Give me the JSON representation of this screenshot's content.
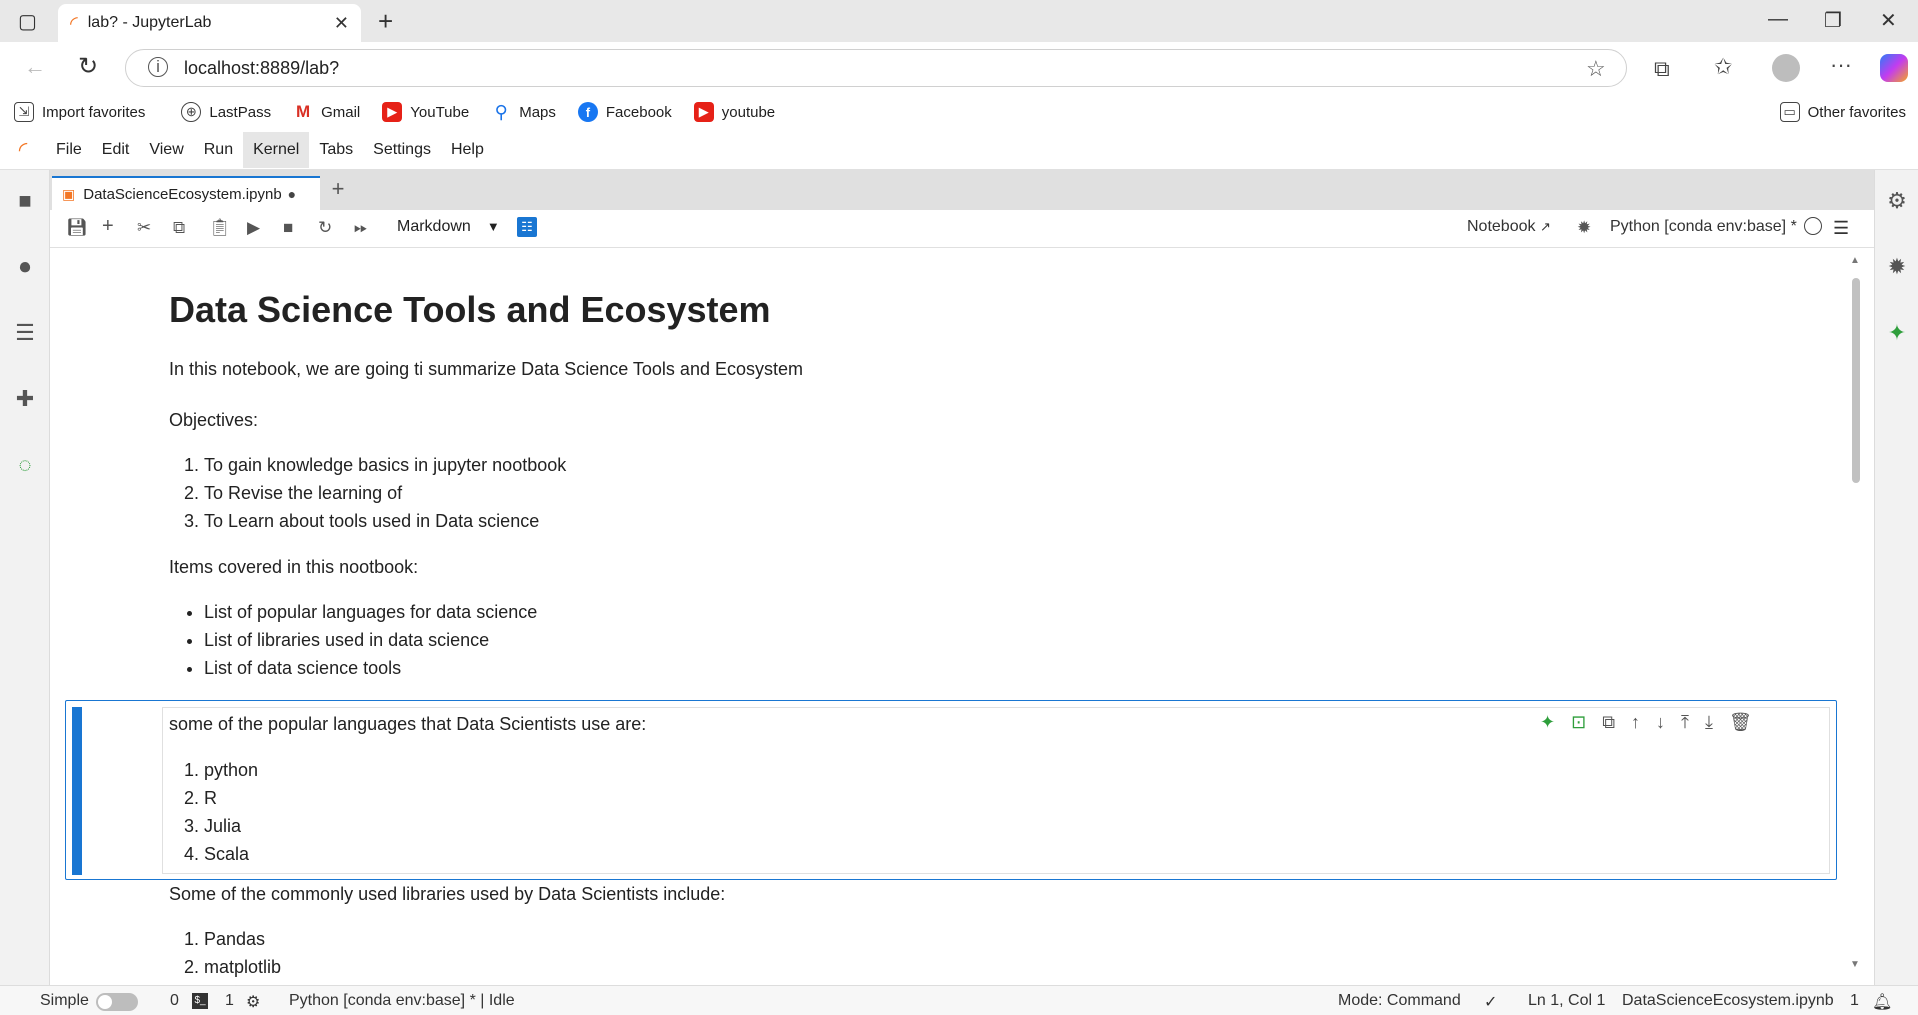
{
  "browser": {
    "tab_title": "lab? - JupyterLab",
    "url": "localhost:8889/lab?",
    "favorites": [
      {
        "label": "Import favorites",
        "icon": "import-icon"
      },
      {
        "label": "LastPass",
        "icon": "globe-icon"
      },
      {
        "label": "Gmail",
        "icon": "gmail-icon"
      },
      {
        "label": "YouTube",
        "icon": "youtube-icon"
      },
      {
        "label": "Maps",
        "icon": "maps-icon"
      },
      {
        "label": "Facebook",
        "icon": "facebook-icon"
      },
      {
        "label": "youtube",
        "icon": "youtube-icon"
      }
    ],
    "other_favorites": "Other favorites"
  },
  "menu": [
    "File",
    "Edit",
    "View",
    "Run",
    "Kernel",
    "Tabs",
    "Settings",
    "Help"
  ],
  "menu_active": "Kernel",
  "notebook": {
    "tab_name": "DataScienceEcosystem.ipynb",
    "cell_type": "Markdown",
    "notebook_label": "Notebook",
    "kernel": "Python [conda env:base] *"
  },
  "cells": {
    "title": "Data Science Tools and Ecosystem",
    "intro": "In this notebook, we are going ti summarize Data Science Tools and Ecosystem",
    "objectives_label": "Objectives:",
    "objectives": [
      "To gain knowledge basics in jupyter nootbook",
      "To Revise the learning of",
      "To Learn about tools used in Data science"
    ],
    "items_label": "Items covered in this nootbook:",
    "items": [
      "List of popular languages for data science",
      "List of libraries used in data science",
      "List of data science tools"
    ],
    "languages_label": "some of the popular languages that Data Scientists use are:",
    "languages": [
      "python",
      "R",
      "Julia",
      "Scala"
    ],
    "libraries_label": "Some of the commonly used libraries used by Data Scientists include:",
    "libraries": [
      "Pandas",
      "matplotlib"
    ]
  },
  "status": {
    "mode_label": "Simple",
    "count_a": "0",
    "count_b": "1",
    "kernel_status": "Python [conda env:base] * | Idle",
    "mode": "Mode: Command",
    "position": "Ln 1, Col 1",
    "file": "DataScienceEcosystem.ipynb",
    "notifications": "1"
  }
}
